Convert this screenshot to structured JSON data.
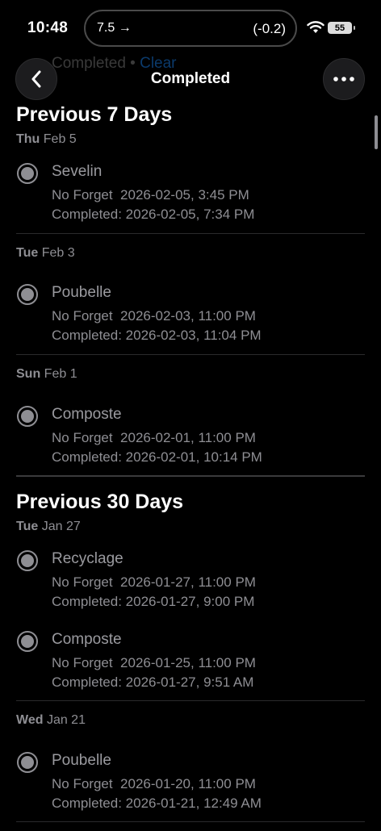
{
  "status": {
    "time": "10:48",
    "island_left": "7.5 →",
    "island_right": "(-0.2)",
    "battery": "55"
  },
  "nav": {
    "ghost_title": "Completed",
    "ghost_dot": "•",
    "ghost_clear": "Clear",
    "title": "Completed"
  },
  "sections": [
    {
      "title": "Previous 7 Days",
      "groups": [
        {
          "day": "Thu",
          "date": "Feb 5",
          "tasks": [
            {
              "name": "Sevelin",
              "due": "No Forget  2026-02-05, 3:45 PM",
              "completed": "Completed: 2026-02-05, 7:34 PM"
            }
          ]
        },
        {
          "day": "Tue",
          "date": "Feb 3",
          "tasks": [
            {
              "name": "Poubelle",
              "due": "No Forget  2026-02-03, 11:00 PM",
              "completed": "Completed: 2026-02-03, 11:04 PM"
            }
          ]
        },
        {
          "day": "Sun",
          "date": "Feb 1",
          "tasks": [
            {
              "name": "Composte",
              "due": "No Forget  2026-02-01, 11:00 PM",
              "completed": "Completed: 2026-02-01, 10:14 PM"
            }
          ]
        }
      ]
    },
    {
      "title": "Previous 30 Days",
      "groups": [
        {
          "day": "Tue",
          "date": "Jan 27",
          "tasks": [
            {
              "name": "Recyclage",
              "due": "No Forget  2026-01-27, 11:00 PM",
              "completed": "Completed: 2026-01-27, 9:00 PM"
            },
            {
              "name": "Composte",
              "due": "No Forget  2026-01-25, 11:00 PM",
              "completed": "Completed: 2026-01-27, 9:51 AM"
            }
          ]
        },
        {
          "day": "Wed",
          "date": "Jan 21",
          "tasks": [
            {
              "name": "Poubelle",
              "due": "No Forget  2026-01-20, 11:00 PM",
              "completed": "Completed: 2026-01-21, 12:49 AM"
            }
          ]
        }
      ]
    }
  ]
}
